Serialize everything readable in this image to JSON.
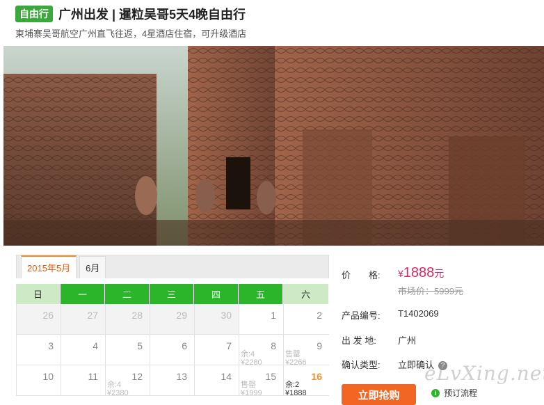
{
  "header": {
    "badge": "自由行",
    "title": "广州出发 | 暹粒吴哥5天4晚自由行",
    "subtitle": "柬埔寨吴哥航空广州直飞往返，4星酒店住宿，可升级酒店"
  },
  "hero": {
    "image": "angkor-temple-photo"
  },
  "calendar": {
    "tabs": [
      {
        "label": "2015年5月",
        "active": true
      },
      {
        "label": "6月",
        "active": false
      }
    ],
    "weekdays": [
      "日",
      "一",
      "二",
      "三",
      "四",
      "五",
      "六"
    ],
    "weeks": [
      [
        {
          "num": "26",
          "past": true
        },
        {
          "num": "27",
          "past": true
        },
        {
          "num": "28",
          "past": true
        },
        {
          "num": "29",
          "past": true
        },
        {
          "num": "30",
          "past": true
        },
        {
          "num": "1"
        },
        {
          "num": "2"
        }
      ],
      [
        {
          "num": "3"
        },
        {
          "num": "4"
        },
        {
          "num": "5"
        },
        {
          "num": "6"
        },
        {
          "num": "7"
        },
        {
          "num": "8",
          "note1": "余:4",
          "note2": "¥2280"
        },
        {
          "num": "9",
          "note1": "售罄",
          "note2": "¥2266"
        }
      ],
      [
        {
          "num": "10"
        },
        {
          "num": "11"
        },
        {
          "num": "12",
          "note1": "余:4",
          "note2": "¥2380"
        },
        {
          "num": "13"
        },
        {
          "num": "14"
        },
        {
          "num": "15",
          "note1": "售罄",
          "note2": "¥1999"
        },
        {
          "num": "16",
          "note1": "余:2",
          "note2": "¥1888",
          "special": true
        }
      ]
    ]
  },
  "info": {
    "price_label": "价　　格:",
    "price_symbol": "¥",
    "price_value": "1888",
    "price_unit": "元",
    "market_price": "市场价：5999元",
    "code_label": "产品编号:",
    "code_value": "T1402069",
    "origin_label": "出 发 地:",
    "origin_value": "广州",
    "confirm_label": "确认类型:",
    "confirm_value": "立即确认",
    "help_icon": "?",
    "buy_button": "立即抢购",
    "flow_icon": "i",
    "flow_link": "预订流程"
  },
  "watermark": "eLvXing.net"
}
